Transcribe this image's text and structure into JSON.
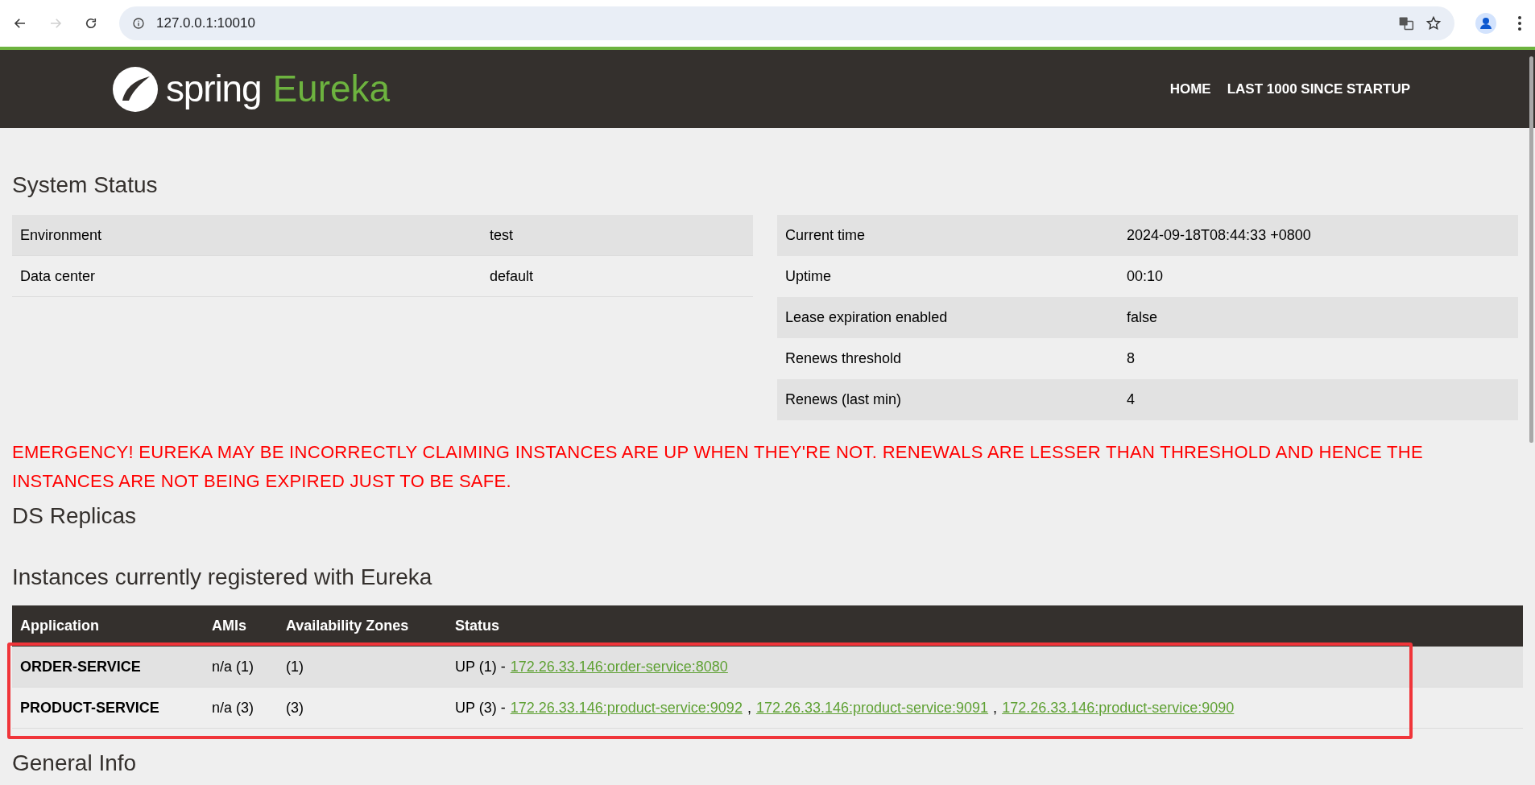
{
  "browser": {
    "url": "127.0.0.1:10010",
    "nav": [
      {
        "kind": "back",
        "disabled": false
      },
      {
        "kind": "forward",
        "disabled": true
      },
      {
        "kind": "reload",
        "disabled": false
      }
    ]
  },
  "header": {
    "logo_word": "spring",
    "logo_product": "Eureka",
    "nav": [
      "HOME",
      "LAST 1000 SINCE STARTUP"
    ]
  },
  "system_status": {
    "title": "System Status",
    "left": [
      {
        "label": "Environment",
        "value": "test"
      },
      {
        "label": "Data center",
        "value": "default"
      }
    ],
    "right": [
      {
        "label": "Current time",
        "value": "2024-09-18T08:44:33 +0800"
      },
      {
        "label": "Uptime",
        "value": "00:10"
      },
      {
        "label": "Lease expiration enabled",
        "value": "false"
      },
      {
        "label": "Renews threshold",
        "value": "8"
      },
      {
        "label": "Renews (last min)",
        "value": "4"
      }
    ]
  },
  "emergency": "EMERGENCY! EUREKA MAY BE INCORRECTLY CLAIMING INSTANCES ARE UP WHEN THEY'RE NOT. RENEWALS ARE LESSER THAN THRESHOLD AND HENCE THE INSTANCES ARE NOT BEING EXPIRED JUST TO BE SAFE.",
  "ds_replicas": {
    "title": "DS Replicas"
  },
  "instances": {
    "title": "Instances currently registered with Eureka",
    "columns": [
      "Application",
      "AMIs",
      "Availability Zones",
      "Status"
    ],
    "rows": [
      {
        "application": "ORDER-SERVICE",
        "amis": "n/a (1)",
        "zones": "(1)",
        "status": [
          {
            "kind": "text",
            "text": "UP (1) -"
          },
          {
            "kind": "link",
            "text": "172.26.33.146:order-service:8080"
          }
        ]
      },
      {
        "application": "PRODUCT-SERVICE",
        "amis": "n/a (3)",
        "zones": "(3)",
        "status": [
          {
            "kind": "text",
            "text": "UP (3) -"
          },
          {
            "kind": "link",
            "text": "172.26.33.146:product-service:9092"
          },
          {
            "kind": "text",
            "text": ","
          },
          {
            "kind": "link",
            "text": "172.26.33.146:product-service:9091"
          },
          {
            "kind": "text",
            "text": ","
          },
          {
            "kind": "link",
            "text": "172.26.33.146:product-service:9090"
          }
        ]
      }
    ]
  },
  "general_info": {
    "title": "General Info"
  }
}
